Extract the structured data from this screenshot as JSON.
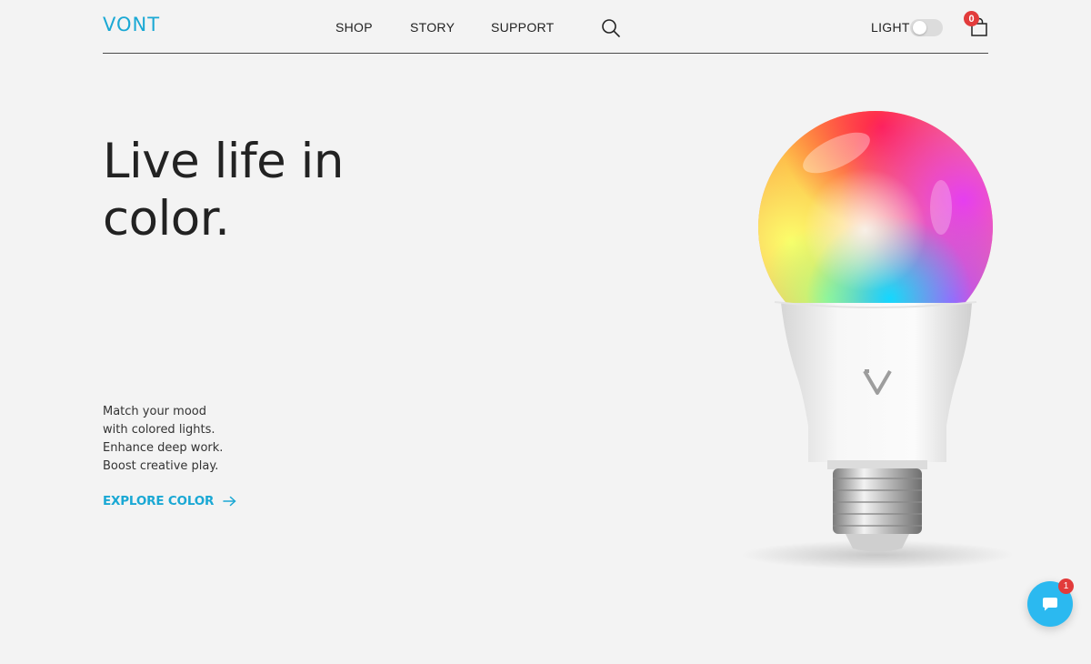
{
  "brand": {
    "logo_text": "VONT",
    "accent_color": "#1aa8d4"
  },
  "nav": {
    "items": [
      {
        "label": "SHOP"
      },
      {
        "label": "STORY"
      },
      {
        "label": "SUPPORT"
      }
    ],
    "search_icon": "search-icon"
  },
  "header_right": {
    "light_label": "LIGHT",
    "light_toggle_on": false,
    "cart_count": "0",
    "cart_icon": "shopping-bag-icon"
  },
  "hero": {
    "title_line1": "Live life in",
    "title_line2": "color.",
    "description": [
      "Match your mood",
      "with colored lights.",
      "Enhance deep work.",
      "Boost creative play."
    ],
    "cta_label": "EXPLORE COLOR",
    "cta_icon": "arrow-right-icon",
    "product_image": "rgb-smart-bulb"
  },
  "chat": {
    "icon": "chat-bubble-icon",
    "badge_count": "1",
    "color": "#2bb9f0"
  }
}
